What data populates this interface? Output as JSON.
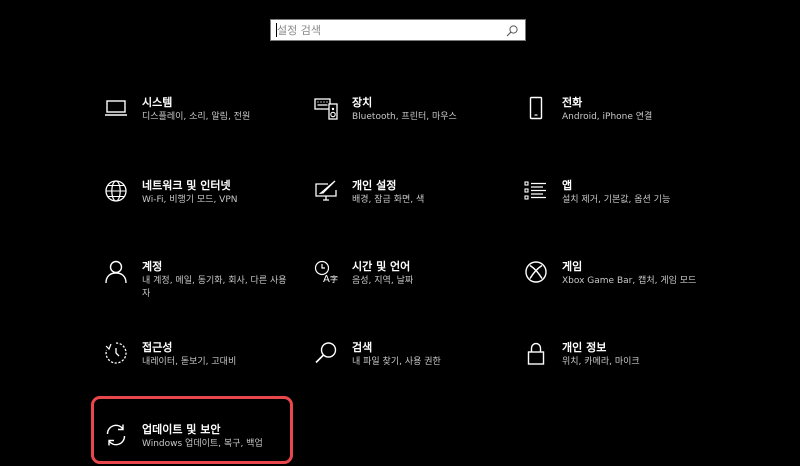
{
  "search": {
    "placeholder": "설정 검색",
    "value": ""
  },
  "tiles": [
    {
      "title": "시스템",
      "desc": "디스플레이, 소리, 알림, 전원",
      "icon": "laptop-icon"
    },
    {
      "title": "장치",
      "desc": "Bluetooth, 프린터, 마우스",
      "icon": "keyboard-speaker-icon"
    },
    {
      "title": "전화",
      "desc": "Android, iPhone 연결",
      "icon": "phone-icon"
    },
    {
      "title": "네트워크 및 인터넷",
      "desc": "Wi-Fi, 비행기 모드, VPN",
      "icon": "globe-icon"
    },
    {
      "title": "개인 설정",
      "desc": "배경, 잠금 화면, 색",
      "icon": "paint-monitor-icon"
    },
    {
      "title": "앱",
      "desc": "설치 제거, 기본값, 옵션 기능",
      "icon": "app-list-icon"
    },
    {
      "title": "계정",
      "desc": "내 계정, 메일, 동기화, 회사, 다른 사용자",
      "icon": "person-icon"
    },
    {
      "title": "시간 및 언어",
      "desc": "음성, 지역, 날짜",
      "icon": "time-language-icon"
    },
    {
      "title": "게임",
      "desc": "Xbox Game Bar, 캡처, 게임 모드",
      "icon": "xbox-icon"
    },
    {
      "title": "접근성",
      "desc": "내레이터, 돋보기, 고대비",
      "icon": "ease-of-access-icon"
    },
    {
      "title": "검색",
      "desc": "내 파일 찾기, 사용 권한",
      "icon": "search-magnifier-icon"
    },
    {
      "title": "개인 정보",
      "desc": "위치, 카메라, 마이크",
      "icon": "lock-icon"
    },
    {
      "title": "업데이트 및 보안",
      "desc": "Windows 업데이트, 복구, 백업",
      "icon": "sync-icon"
    }
  ],
  "colors": {
    "background": "#000000",
    "highlight": "#e8484d",
    "text": "#ffffff",
    "subtext": "#c8c8c8"
  }
}
